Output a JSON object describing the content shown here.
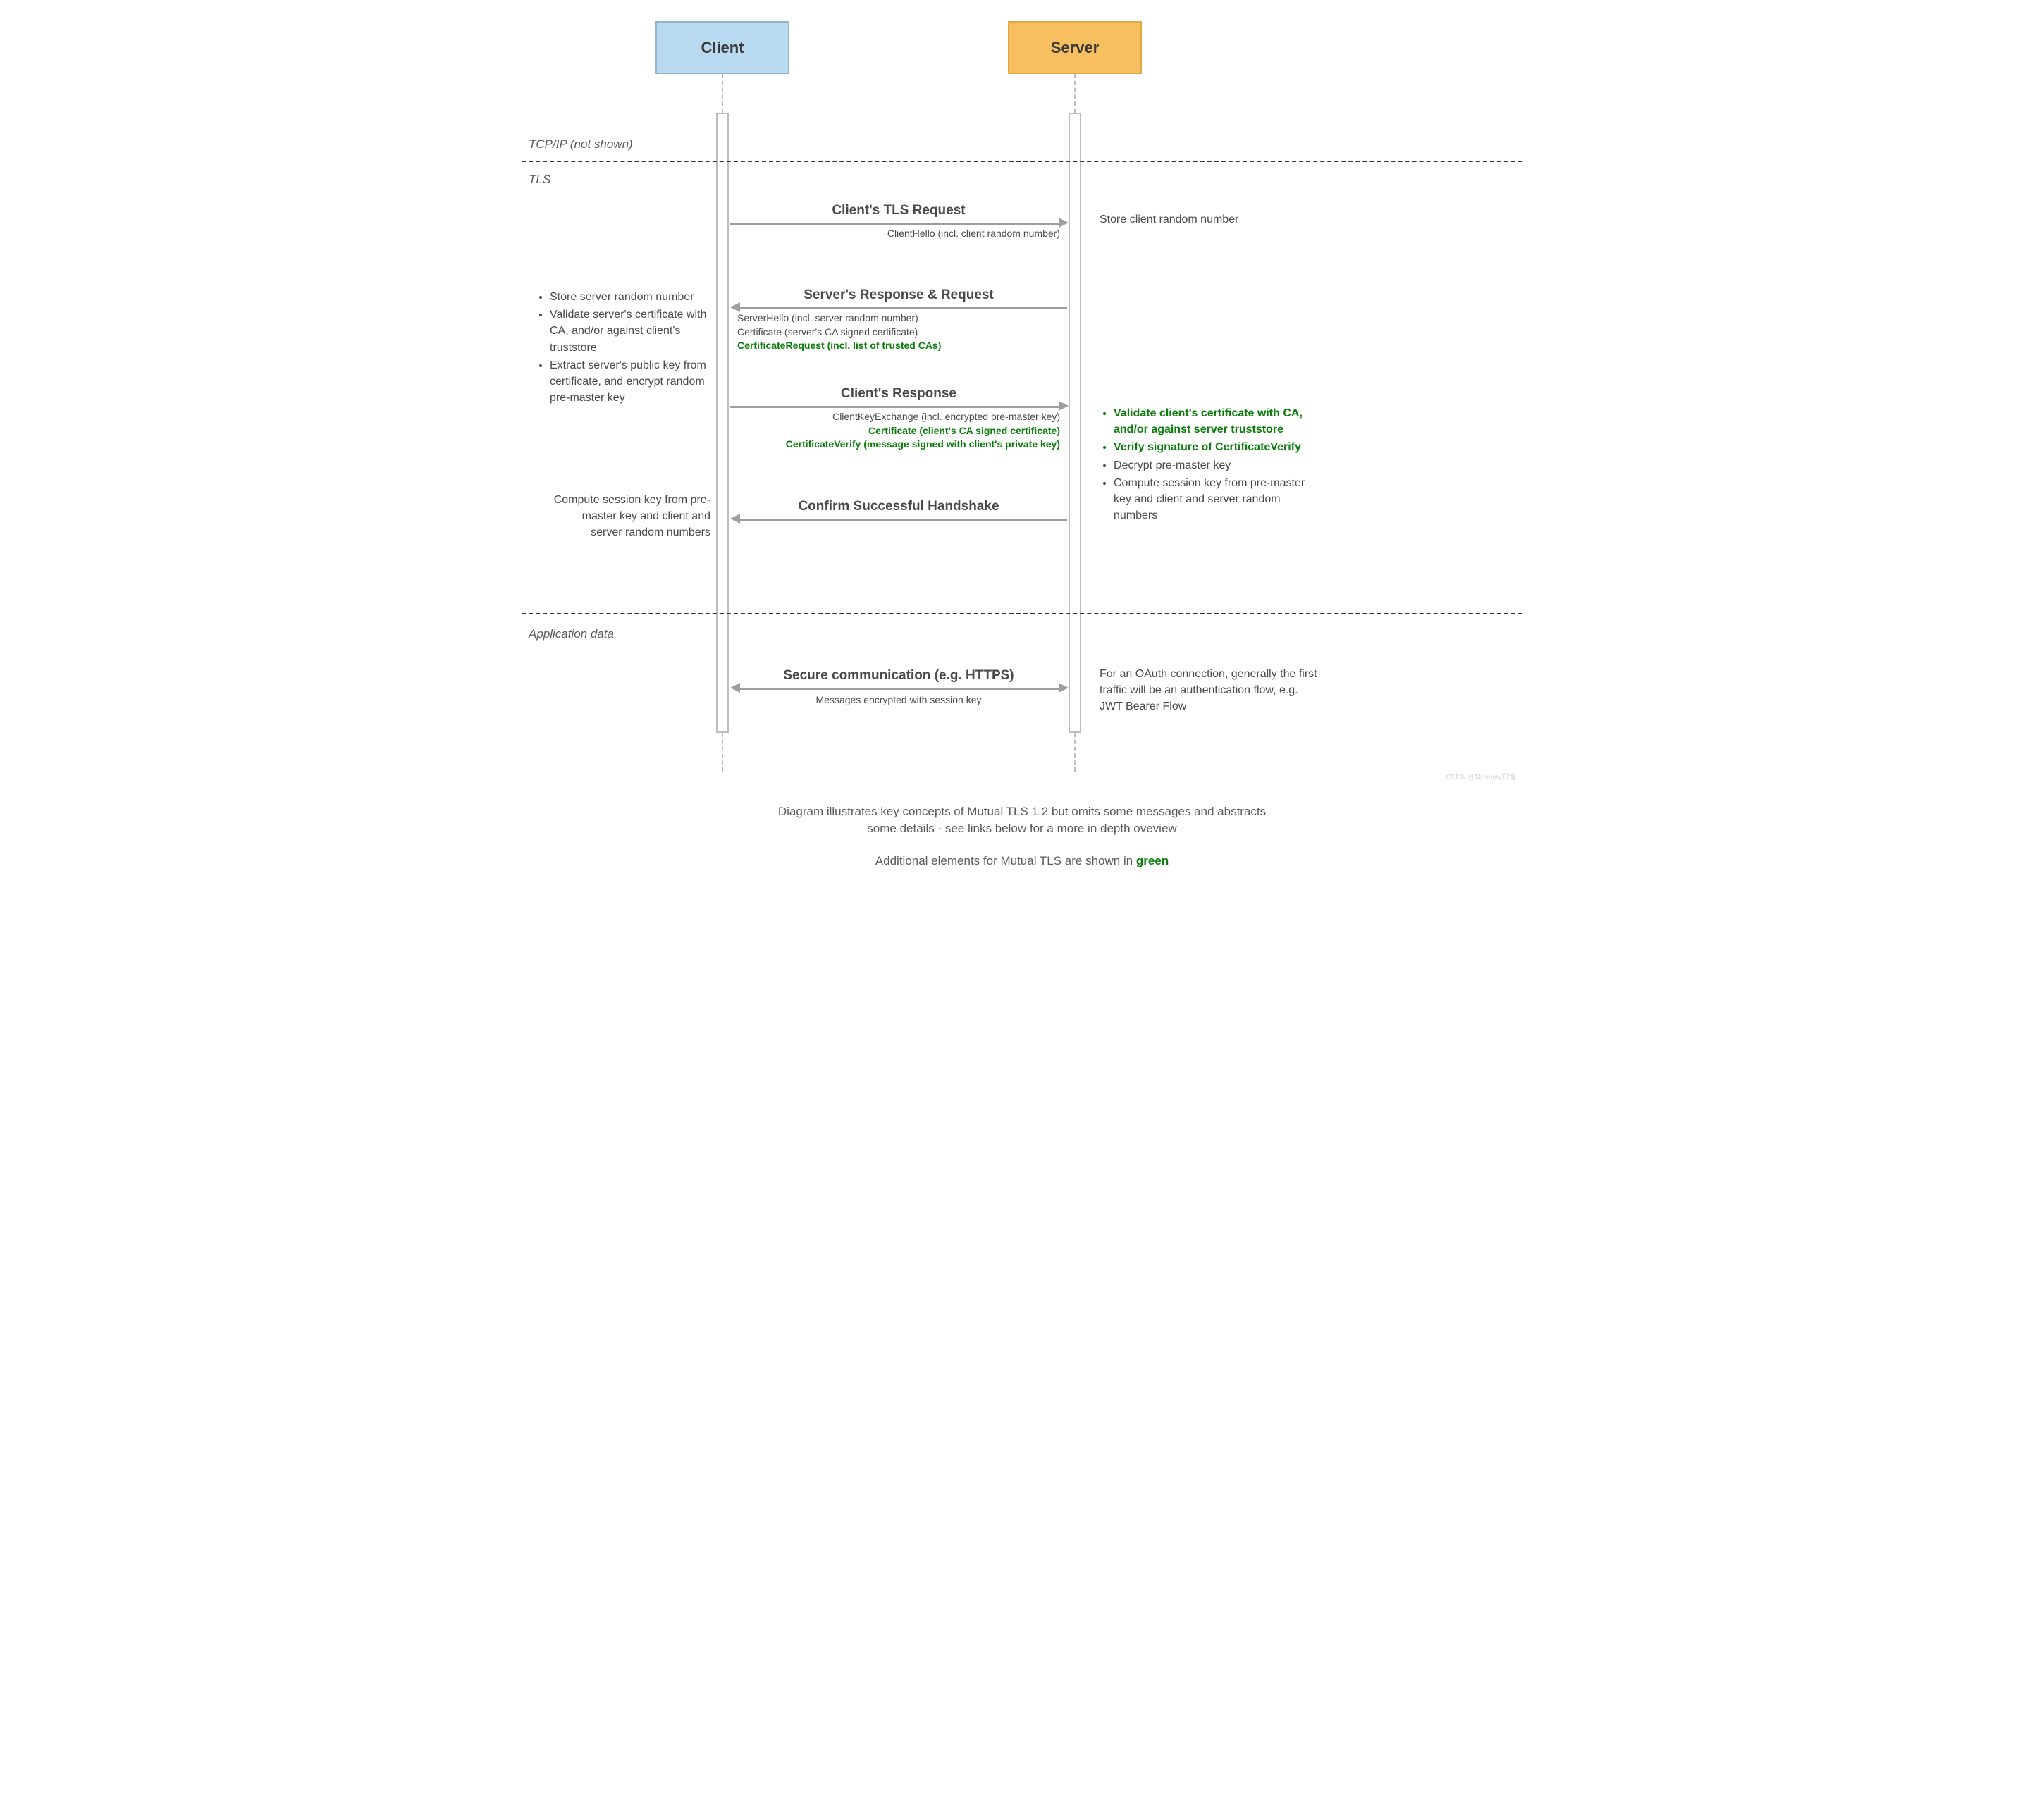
{
  "actors": {
    "client": "Client",
    "server": "Server"
  },
  "sections": {
    "tcp": "TCP/IP (not shown)",
    "tls": "TLS",
    "app": "Application data"
  },
  "messages": {
    "m1": {
      "title": "Client's TLS Request",
      "sub1": "ClientHello (incl. client random number)"
    },
    "m2": {
      "title": "Server's Response & Request",
      "sub1": "ServerHello (incl. server random number)",
      "sub2": "Certificate (server's CA signed certificate)",
      "sub3": "CertificateRequest (incl. list of trusted CAs)"
    },
    "m3": {
      "title": "Client's Response",
      "sub1": "ClientKeyExchange (incl. encrypted pre-master key)",
      "sub2": "Certificate (client's CA signed certificate)",
      "sub3": "CertificateVerify (message signed with client's private key)"
    },
    "m4": {
      "title": "Confirm Successful Handshake"
    },
    "m5": {
      "title": "Secure communication (e.g. HTTPS)",
      "sub1": "Messages encrypted with session key"
    }
  },
  "notes": {
    "n1": "Store client random number",
    "n2a": "Store server random number",
    "n2b": "Validate server's certificate with CA, and/or against client's truststore",
    "n2c": "Extract server's public key from certificate, and encrypt random pre-master key",
    "n3a": "Validate client's certificate with CA, and/or against server truststore",
    "n3b": "Verify signature of CertificateVerify",
    "n3c": "Decrypt pre-master key",
    "n3d": "Compute session key from pre-master key and client and server random numbers",
    "n4": "Compute session key from pre-master key and client and server random numbers",
    "n5": "For an OAuth connection, generally the first traffic will be an authentication flow, e.g. JWT Bearer Flow"
  },
  "footer": {
    "line1": "Diagram illustrates key concepts of Mutual TLS 1.2 but omits some messages and abstracts some details - see links below for a more in depth oveview",
    "line2a": "Additional elements for Mutual TLS are shown in ",
    "line2b": "green"
  },
  "watermark": "CSDN @Moshow郑锴"
}
